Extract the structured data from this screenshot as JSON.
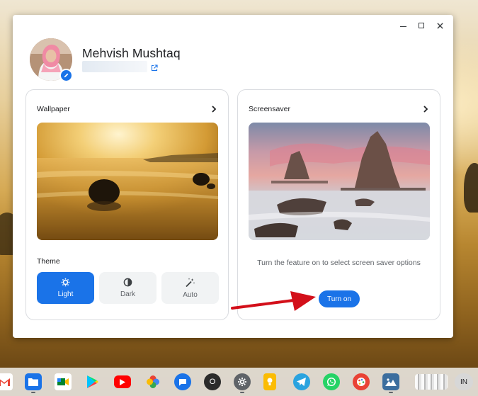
{
  "window": {
    "controls": [
      "minimize",
      "maximize",
      "close"
    ]
  },
  "profile": {
    "name": "Mehvish Mushtaq",
    "edit_icon": "pencil-icon",
    "email_link_icon": "external-link-icon"
  },
  "wallpaper_card": {
    "title": "Wallpaper",
    "theme_label": "Theme",
    "theme_options": [
      {
        "label": "Light",
        "icon": "sun-gear-icon",
        "selected": true
      },
      {
        "label": "Dark",
        "icon": "half-circle-icon",
        "selected": false
      },
      {
        "label": "Auto",
        "icon": "magic-wand-icon",
        "selected": false
      }
    ]
  },
  "screensaver_card": {
    "title": "Screensaver",
    "description": "Turn the feature on to select screen saver options",
    "button_label": "Turn on"
  },
  "shelf": {
    "apps": [
      "gmail",
      "files",
      "google-meet",
      "play-store",
      "youtube",
      "photos",
      "messages",
      "opera",
      "settings",
      "keep",
      "telegram",
      "whatsapp",
      "paint",
      "gallery"
    ],
    "opera_letter": "O",
    "input_method": "IN"
  },
  "colors": {
    "accent": "#1a73e8",
    "arrow": "#d3101a"
  }
}
